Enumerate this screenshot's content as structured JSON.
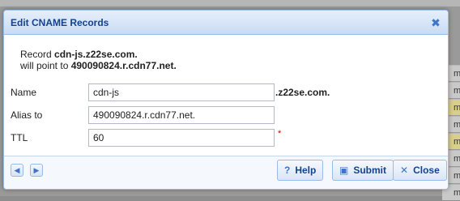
{
  "background": {
    "items": [
      "m",
      "m",
      "m",
      "m",
      "m",
      "m",
      "m",
      "m",
      "m"
    ]
  },
  "dialog": {
    "title": "Edit CNAME Records",
    "info": {
      "line1_prefix": "Record ",
      "record": "cdn-js.z22se.com.",
      "line2_prefix": "will point to ",
      "target": "490090824.r.cdn77.net."
    },
    "fields": {
      "name_label": "Name",
      "name_value": "cdn-js",
      "name_suffix": ".z22se.com.",
      "alias_label": "Alias to",
      "alias_value": "490090824.r.cdn77.net.",
      "ttl_label": "TTL",
      "ttl_value": "60",
      "required_mark": "*"
    },
    "buttons": {
      "help": "Help",
      "submit": "Submit",
      "close": "Close"
    }
  }
}
